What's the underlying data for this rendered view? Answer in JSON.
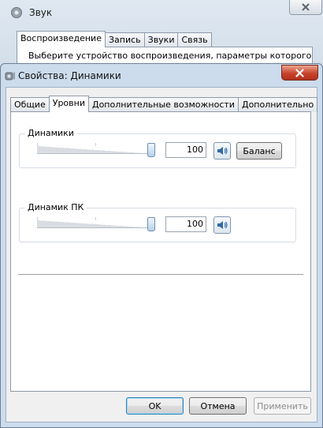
{
  "background_window": {
    "title": "Звук",
    "tabs": [
      "Воспроизведение",
      "Запись",
      "Звуки",
      "Связь"
    ],
    "active_tab": 0,
    "description": "Выберите устройство воспроизведения, параметры которого"
  },
  "dialog": {
    "title": "Свойства: Динамики",
    "tabs": [
      {
        "label": "Общие"
      },
      {
        "label": "Уровни"
      },
      {
        "label": "Дополнительные возможности"
      },
      {
        "label": "Дополнительно"
      }
    ],
    "active_tab": 1,
    "groups": [
      {
        "label": "Динамики",
        "value": "100",
        "level": 1.0,
        "balance_label": "Баланс"
      },
      {
        "label": "Динамик ПК",
        "value": "100",
        "level": 1.0
      }
    ],
    "buttons": {
      "ok": "OK",
      "cancel": "Отмена",
      "apply": "Применить"
    }
  },
  "icons": {
    "window_icon": "speaker-gear-icon",
    "speaker": "speaker-icon",
    "close": "close-icon"
  },
  "colors": {
    "close_button": "#c7432c",
    "default_button_border": "#3c7fb1",
    "slider_thumb": "#b6d1ea"
  }
}
